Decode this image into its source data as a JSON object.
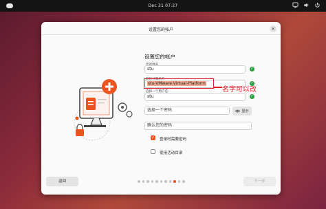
{
  "topbar": {
    "clock": "Dec 31  07:27",
    "icons": [
      "network-icon",
      "volume-icon",
      "power-icon"
    ]
  },
  "dialog": {
    "title": "设置您的帐户",
    "close_label": "×",
    "heading": "设置您的帐户",
    "fields": {
      "name_label": "您的姓名",
      "name_value": "stu",
      "computer_label": "您的计算机名",
      "computer_value": "stu-VMware-Virtual-Platform",
      "username_label": "选择一个用户名",
      "username_value": "stu",
      "password_placeholder": "选择一个密码",
      "confirm_placeholder": "确认您的密码"
    },
    "show_button_label": "显示",
    "checkboxes": {
      "require_password_label": "登录时需要密码",
      "require_password_checked": true,
      "active_directory_label": "使用活动目录",
      "active_directory_checked": false
    },
    "back_label": "返回",
    "next_label": "下一步",
    "pager": {
      "total": 11,
      "current": 9
    },
    "check_mark": "✓"
  },
  "annotation": {
    "text": "名字可以改",
    "color": "#e0202a"
  },
  "colors": {
    "accent": "#e95420",
    "success": "#2ea043"
  }
}
